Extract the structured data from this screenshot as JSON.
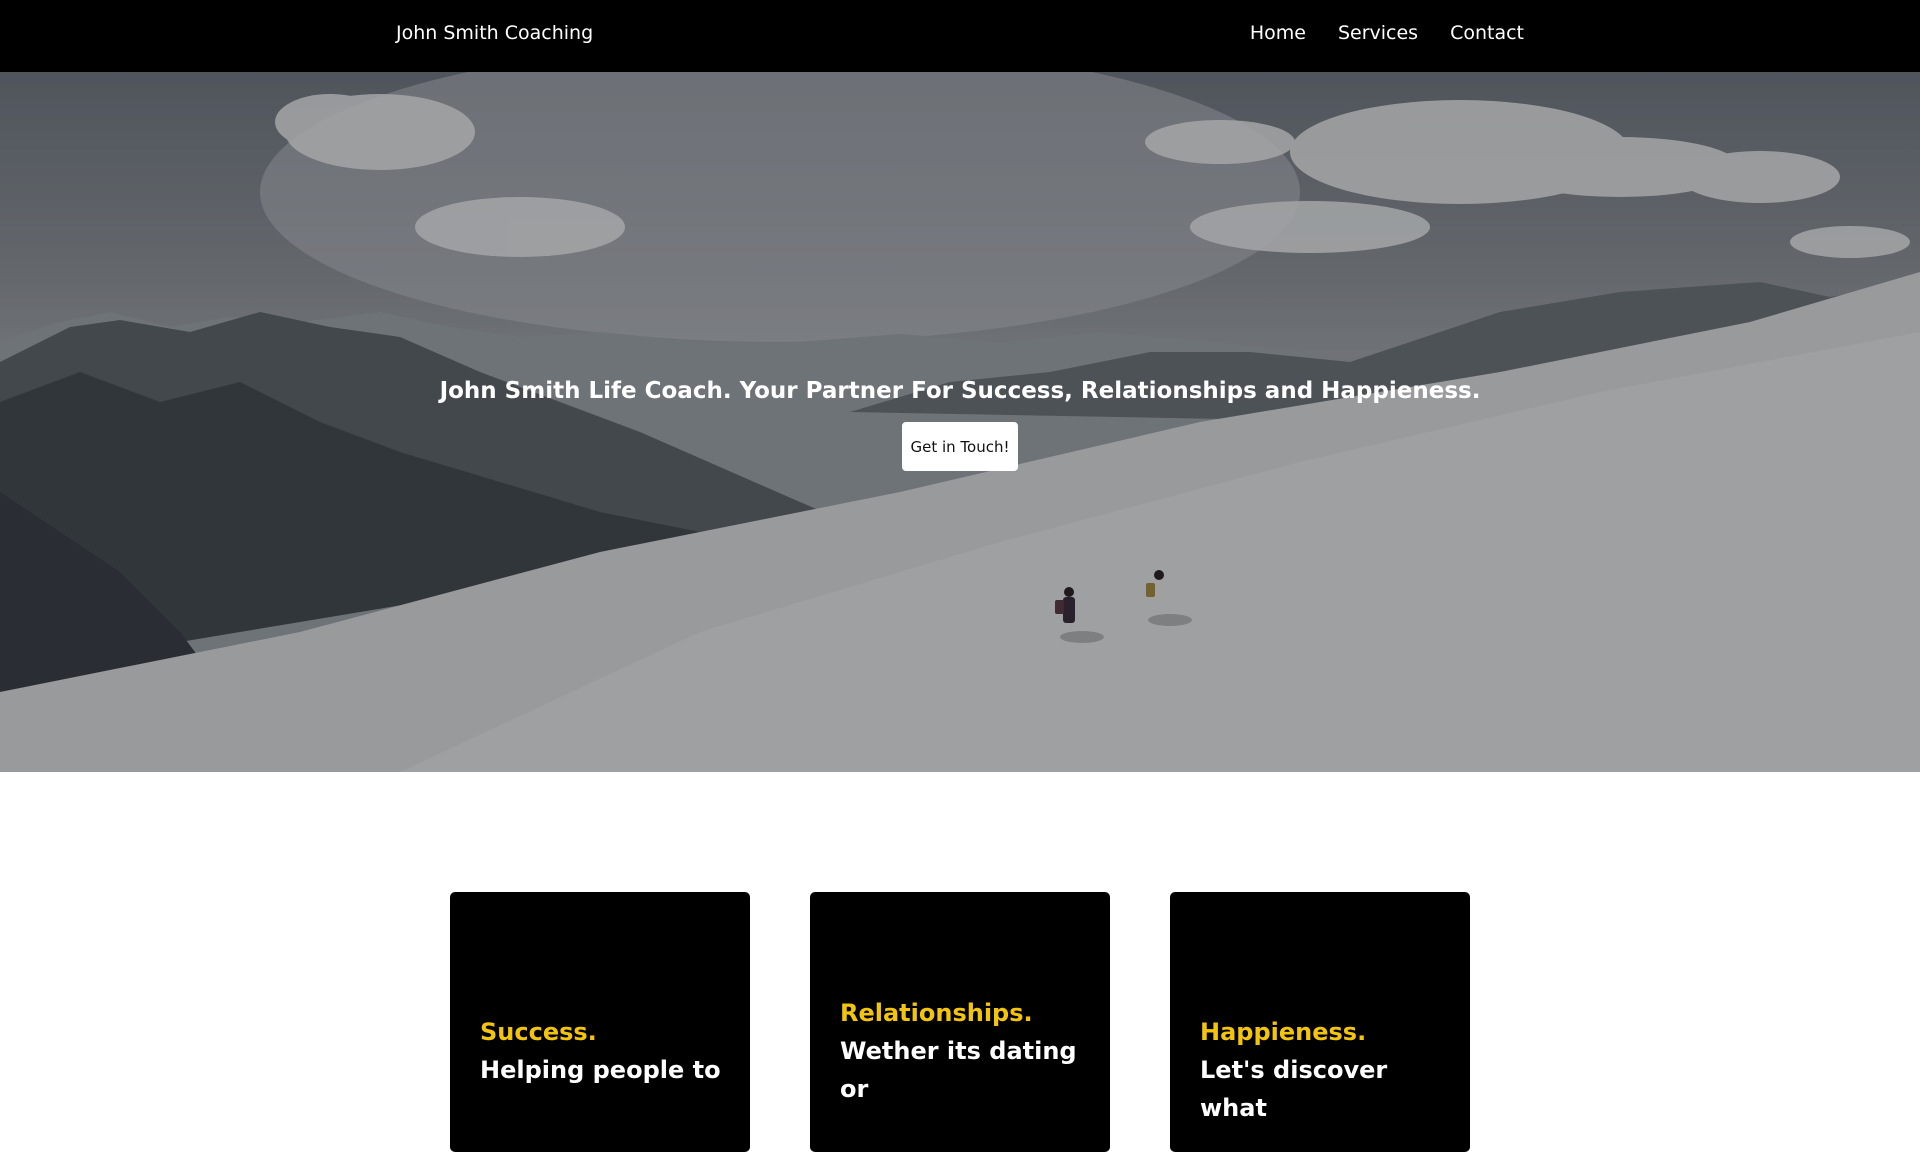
{
  "nav": {
    "brand": "John Smith Coaching",
    "links": [
      "Home",
      "Services",
      "Contact"
    ]
  },
  "hero": {
    "heading": "John Smith Life Coach. Your Partner For Success, Relationships and Happieness.",
    "button_label": "Get in Touch!"
  },
  "cards": [
    {
      "title": "Success.",
      "text": "Helping people to"
    },
    {
      "title": "Relationships.",
      "text": "Wether its dating or"
    },
    {
      "title": "Happieness.",
      "text": "Let's discover what"
    }
  ],
  "colors": {
    "navbar_bg": "#000000",
    "card_bg": "#000000",
    "accent": "#f2c40b",
    "button_bg": "#ffffff"
  }
}
